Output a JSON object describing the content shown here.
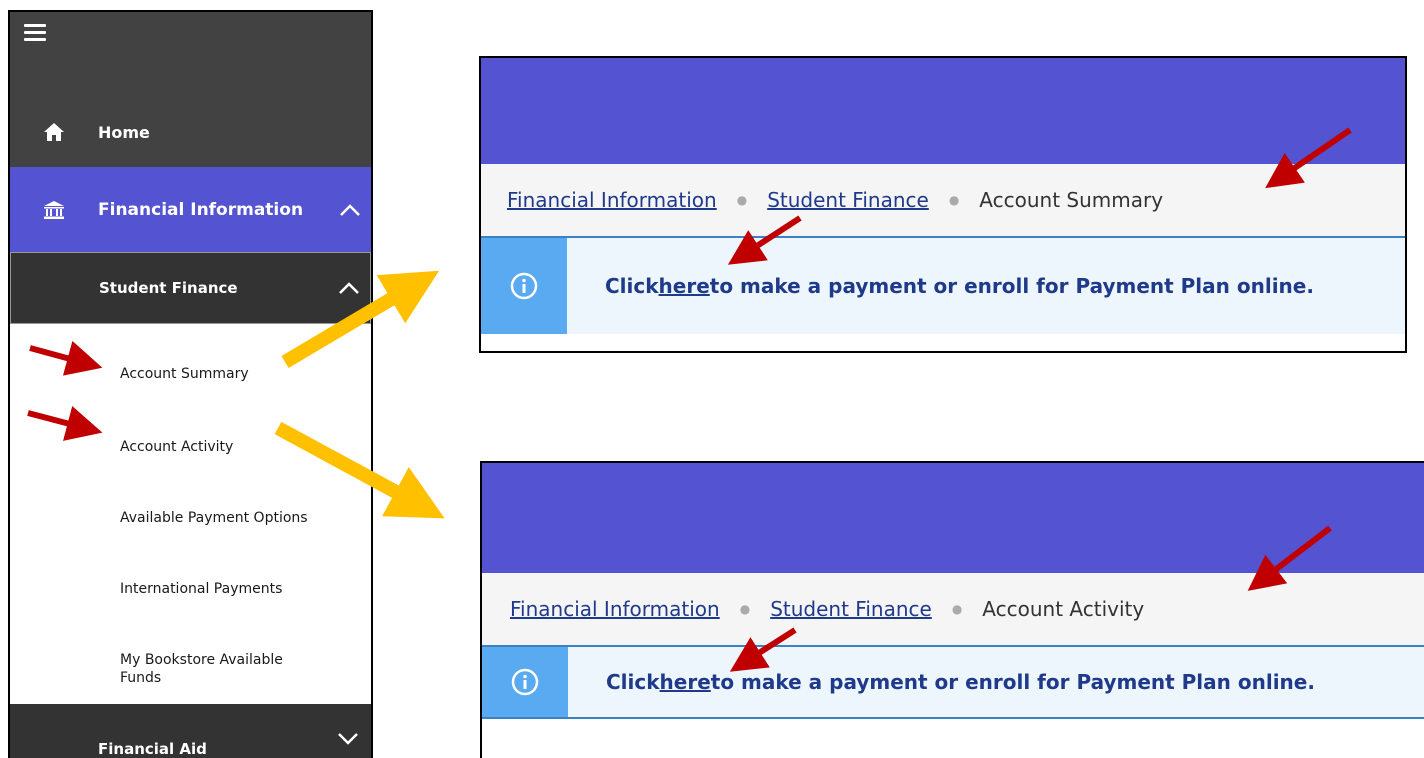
{
  "sidebar": {
    "home_label": "Home",
    "financial_info_label": "Financial Information",
    "student_finance_label": "Student Finance",
    "sub_items": [
      "Account Summary",
      "Account Activity",
      "Available Payment Options",
      "International Payments",
      "My Bookstore Available",
      "Funds"
    ],
    "financial_aid_label": "Financial Aid"
  },
  "panels": [
    {
      "breadcrumb": [
        "Financial Information",
        "Student Finance"
      ],
      "current": "Account Summary",
      "info": {
        "pre": "Click ",
        "link": "here",
        "post": " to make a payment or enroll for Payment Plan online."
      }
    },
    {
      "breadcrumb": [
        "Financial Information",
        "Student Finance"
      ],
      "current": "Account Activity",
      "info": {
        "pre": "Click ",
        "link": "here",
        "post": " to make a payment or enroll for Payment Plan online."
      }
    }
  ],
  "colors": {
    "brand_purple": "#5453d2",
    "sidebar_dark": "#424242",
    "sidebar_darker": "#333333",
    "info_accent": "#5aaaf2",
    "red_arrow": "#c00000",
    "yellow_arrow": "#ffc000"
  },
  "icons": [
    "hamburger-menu-icon",
    "home-icon",
    "bank-icon",
    "chevron-up-icon",
    "chevron-down-icon",
    "info-icon"
  ]
}
